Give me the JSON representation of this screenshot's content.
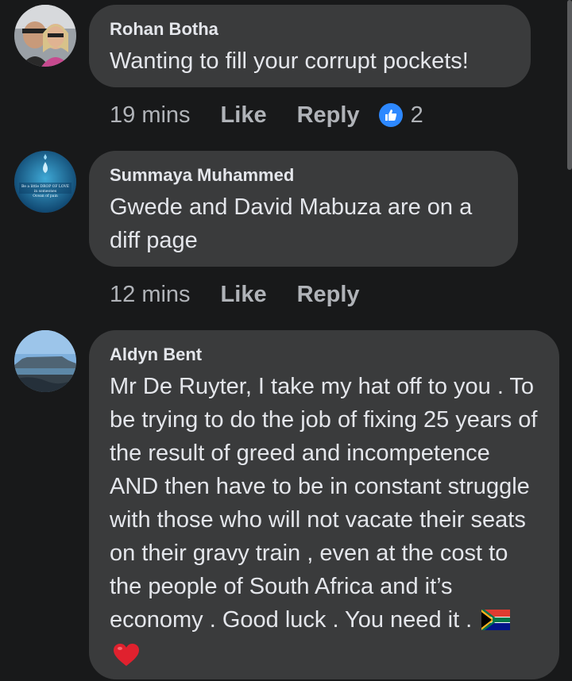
{
  "comments": [
    {
      "author": "Rohan Botha",
      "text": "Wanting to fill your corrupt pockets!",
      "time": "19 mins",
      "like_label": "Like",
      "reply_label": "Reply",
      "reaction_count": "2",
      "avatar_icon": "profile-photo-couple"
    },
    {
      "author": "Summaya Muhammed",
      "text": "Gwede and David Mabuza are on a diff page",
      "time": "12 mins",
      "like_label": "Like",
      "reply_label": "Reply",
      "avatar_icon": "profile-photo-drop-of-love",
      "avatar_text_1": "Be a little DROP OF LOVE",
      "avatar_text_2": "in someones",
      "avatar_text_3": "Ocean of pain"
    },
    {
      "author": "Aldyn Bent",
      "text": "Mr De Ruyter, I take my hat off to you . To be trying to do the job of fixing 25 years of the result of greed and incompetence AND then have to be in constant struggle with those who will not vacate their seats on their gravy train , even at the cost to the people of South Africa and it’s economy . Good luck . You need it . ",
      "avatar_icon": "profile-photo-table-mountain",
      "emojis": [
        "south-africa-flag-icon",
        "red-heart-icon"
      ]
    }
  ],
  "colors": {
    "background": "#18191a",
    "bubble": "#3a3b3c",
    "primary_text": "#e4e6eb",
    "secondary_text": "#b0b3b8",
    "like_blue": "#2d88ff"
  }
}
